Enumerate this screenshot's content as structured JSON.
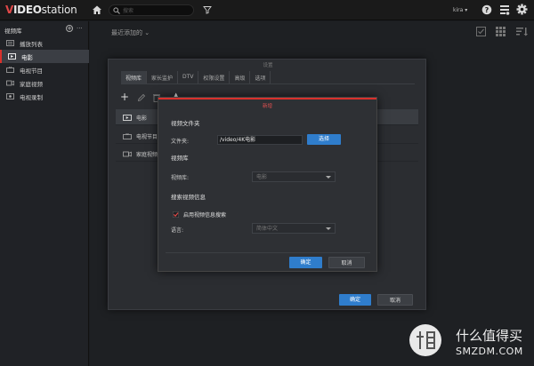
{
  "app": {
    "logo": {
      "part1": "V",
      "part2": "IDEO",
      "part3": "station"
    },
    "search_placeholder": "搜索",
    "user": "kira ▾"
  },
  "sidebar": {
    "title": "视频库",
    "add_symbol": "+",
    "more_symbol": "···",
    "items": [
      {
        "label": "播放列表",
        "icon": "playlist-icon"
      },
      {
        "label": "电影",
        "icon": "movie-icon",
        "active": true
      },
      {
        "label": "电视节目",
        "icon": "tv-icon"
      },
      {
        "label": "家庭视频",
        "icon": "home-video-icon"
      },
      {
        "label": "电视录制",
        "icon": "tv-record-icon"
      }
    ]
  },
  "main": {
    "recent_label": "最近添加的 ⌄"
  },
  "settings_dialog": {
    "title": "设置",
    "tabs": [
      "视频库",
      "家长监护",
      "DTV",
      "权限设置",
      "高级",
      "选项"
    ],
    "active_tab": 0,
    "add_symbol": "+",
    "up_symbol": "▲",
    "rows": [
      {
        "label": "电影",
        "icon": "movie-icon"
      },
      {
        "label": "电视节目",
        "icon": "tv-icon"
      },
      {
        "label": "家庭视频",
        "icon": "home-video-icon"
      }
    ],
    "ok_label": "确定",
    "cancel_label": "取消"
  },
  "modal": {
    "title": "新增",
    "folder_section": "视频文件夹",
    "folder_label": "文件夹:",
    "folder_value": "/video/4K电影",
    "choose_label": "选择",
    "library_section": "视频库",
    "library_label": "视频库:",
    "library_value": "电影",
    "search_section": "搜索视频信息",
    "enable_label": "启用视频信息搜索",
    "enable_checked": true,
    "language_label": "语言:",
    "language_value": "简体中文",
    "ok_label": "确定",
    "cancel_label": "取消"
  },
  "watermark": {
    "text1": "什么值得买",
    "text2": "SMZDM.COM"
  },
  "colors": {
    "accent_red": "#d9302c",
    "primary_blue": "#2f7dcc",
    "background": "#1e2023"
  }
}
